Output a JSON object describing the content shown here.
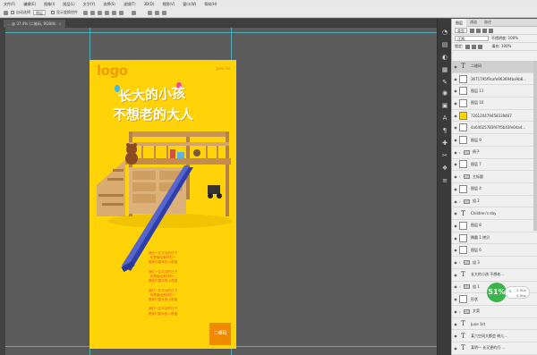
{
  "menu": [
    "文件(F)",
    "编辑(E)",
    "图像(I)",
    "图层(L)",
    "文字(Y)",
    "选择(S)",
    "滤镜(T)",
    "3D(D)",
    "视图(V)",
    "窗口(W)",
    "帮助(H)"
  ],
  "options": {
    "auto_select_label": "自动选择",
    "target": "图层",
    "transform_label": "显示变换控件"
  },
  "document_tab": {
    "label": "... @ 37.4% (二维码, RGB/8)",
    "close": "×"
  },
  "poster": {
    "logo": "logo",
    "date": "June 1st",
    "title_line1": "长大的小孩",
    "title_line2": "不想老的大人",
    "captions": [
      "我们一生平淡的日子",
      "也是曾经美好的一",
      "是我们童年的小愿望",
      "",
      "我们一生平淡的日子",
      "也是曾经美好的一",
      "是我们童年的小愿望",
      "",
      "我们一生平淡的日子",
      "也是曾经美好的一",
      "是我们童年的小愿望",
      "",
      "我们一生平淡的日子",
      "是我们童年的小愿望"
    ],
    "qr_label": "二维码"
  },
  "panel": {
    "tabs": [
      "图层",
      "通道",
      "路径"
    ],
    "filter_label": "类型",
    "blend_mode": "正常",
    "opacity_label": "不透明度: 100%",
    "lock_label": "锁定:",
    "fill_label": "填充: 100%"
  },
  "layers": [
    {
      "type": "text",
      "name": "二维码",
      "selected": true
    },
    {
      "type": "image",
      "name": "3671795f9cafe963694ba9b8...",
      "selected": false
    },
    {
      "type": "image",
      "name": "图层 11",
      "selected": false
    },
    {
      "type": "image",
      "name": "图层 10",
      "selected": false
    },
    {
      "type": "image-yellow",
      "name": "726120479458339467",
      "selected": false
    },
    {
      "type": "image",
      "name": "4a64025783f47f5b43fe0da4...",
      "selected": false
    },
    {
      "type": "image",
      "name": "图层 9",
      "selected": false
    },
    {
      "type": "group",
      "name": "椅子",
      "selected": false
    },
    {
      "type": "image",
      "name": "图层 7",
      "selected": false
    },
    {
      "type": "group",
      "name": "主标题",
      "selected": false
    },
    {
      "type": "image",
      "name": "图层 4",
      "selected": false
    },
    {
      "type": "group",
      "name": "组 2",
      "selected": false
    },
    {
      "type": "text",
      "name": "Children's day",
      "selected": false
    },
    {
      "type": "image",
      "name": "图层 8",
      "selected": false
    },
    {
      "type": "image",
      "name": "椭圆 1 拷贝",
      "selected": false
    },
    {
      "type": "image",
      "name": "图层 6",
      "selected": false
    },
    {
      "type": "group",
      "name": "组 3",
      "selected": false
    },
    {
      "type": "text",
      "name": "长大的小孩 不想老...",
      "selected": false
    },
    {
      "type": "group",
      "name": "组 1",
      "selected": false
    },
    {
      "type": "image",
      "name": "形状",
      "selected": false
    },
    {
      "type": "group",
      "name": "文案",
      "selected": false
    },
    {
      "type": "text",
      "name": "June 1st",
      "selected": false
    },
    {
      "type": "text",
      "name": "某六空间大都会 俯儿...",
      "selected": false
    },
    {
      "type": "text",
      "name": "某明一 长又更的打 ...",
      "selected": false
    }
  ],
  "status": {
    "badge": "51%",
    "up": "0.1K/s",
    "down": "0.1K/s"
  },
  "colors": {
    "poster_bg": "#ffd308",
    "logo": "#f29a00",
    "guide": "#4ec7da",
    "slide": "#2f3fa8",
    "wood": "#d3a56a"
  }
}
